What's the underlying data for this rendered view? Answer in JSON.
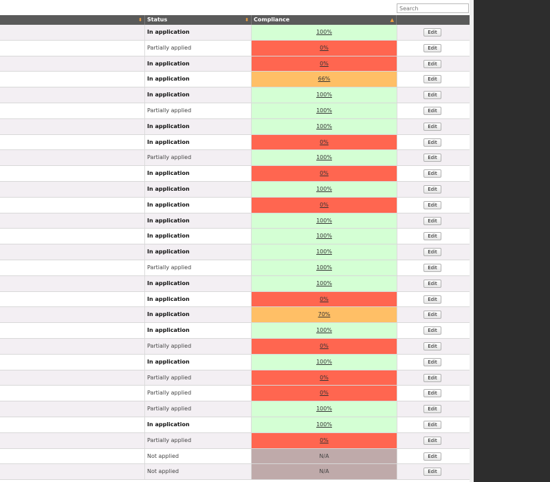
{
  "search": {
    "placeholder": "Search"
  },
  "header": {
    "status": "Status",
    "compliance": "Compliance"
  },
  "colors": {
    "green": "#d4ffd4",
    "red": "#ff6650",
    "orange": "#ffbf66",
    "gray": "#bfaaaa"
  },
  "edit_label": "Edit",
  "rows": [
    {
      "status": "In application",
      "bold": true,
      "compliance": "100%",
      "level": "green"
    },
    {
      "status": "Partially applied",
      "bold": false,
      "compliance": "0%",
      "level": "red"
    },
    {
      "status": "In application",
      "bold": true,
      "compliance": "0%",
      "level": "red"
    },
    {
      "status": "In application",
      "bold": true,
      "compliance": "66%",
      "level": "orange"
    },
    {
      "status": "In application",
      "bold": true,
      "compliance": "100%",
      "level": "green"
    },
    {
      "status": "Partially applied",
      "bold": false,
      "compliance": "100%",
      "level": "green"
    },
    {
      "status": "In application",
      "bold": true,
      "compliance": "100%",
      "level": "green"
    },
    {
      "status": "In application",
      "bold": true,
      "compliance": "0%",
      "level": "red"
    },
    {
      "status": "Partially applied",
      "bold": false,
      "compliance": "100%",
      "level": "green"
    },
    {
      "status": "In application",
      "bold": true,
      "compliance": "0%",
      "level": "red"
    },
    {
      "status": "In application",
      "bold": true,
      "compliance": "100%",
      "level": "green"
    },
    {
      "status": "In application",
      "bold": true,
      "compliance": "0%",
      "level": "red"
    },
    {
      "status": "In application",
      "bold": true,
      "compliance": "100%",
      "level": "green"
    },
    {
      "status": "In application",
      "bold": true,
      "compliance": "100%",
      "level": "green"
    },
    {
      "status": "In application",
      "bold": true,
      "compliance": "100%",
      "level": "green"
    },
    {
      "status": "Partially applied",
      "bold": false,
      "compliance": "100%",
      "level": "green"
    },
    {
      "status": "In application",
      "bold": true,
      "compliance": "100%",
      "level": "green"
    },
    {
      "status": "In application",
      "bold": true,
      "compliance": "0%",
      "level": "red"
    },
    {
      "status": "In application",
      "bold": true,
      "compliance": "70%",
      "level": "orange"
    },
    {
      "status": "In application",
      "bold": true,
      "compliance": "100%",
      "level": "green"
    },
    {
      "status": "Partially applied",
      "bold": false,
      "compliance": "0%",
      "level": "red"
    },
    {
      "status": "In application",
      "bold": true,
      "compliance": "100%",
      "level": "green"
    },
    {
      "status": "Partially applied",
      "bold": false,
      "compliance": "0%",
      "level": "red"
    },
    {
      "status": "Partially applied",
      "bold": false,
      "compliance": "0%",
      "level": "red"
    },
    {
      "status": "Partially applied",
      "bold": false,
      "compliance": "100%",
      "level": "green"
    },
    {
      "status": "In application",
      "bold": true,
      "compliance": "100%",
      "level": "green"
    },
    {
      "status": "Partially applied",
      "bold": false,
      "compliance": "0%",
      "level": "red"
    },
    {
      "status": "Not applied",
      "bold": false,
      "compliance": "N/A",
      "level": "gray"
    },
    {
      "status": "Not applied",
      "bold": false,
      "compliance": "N/A",
      "level": "gray"
    }
  ]
}
